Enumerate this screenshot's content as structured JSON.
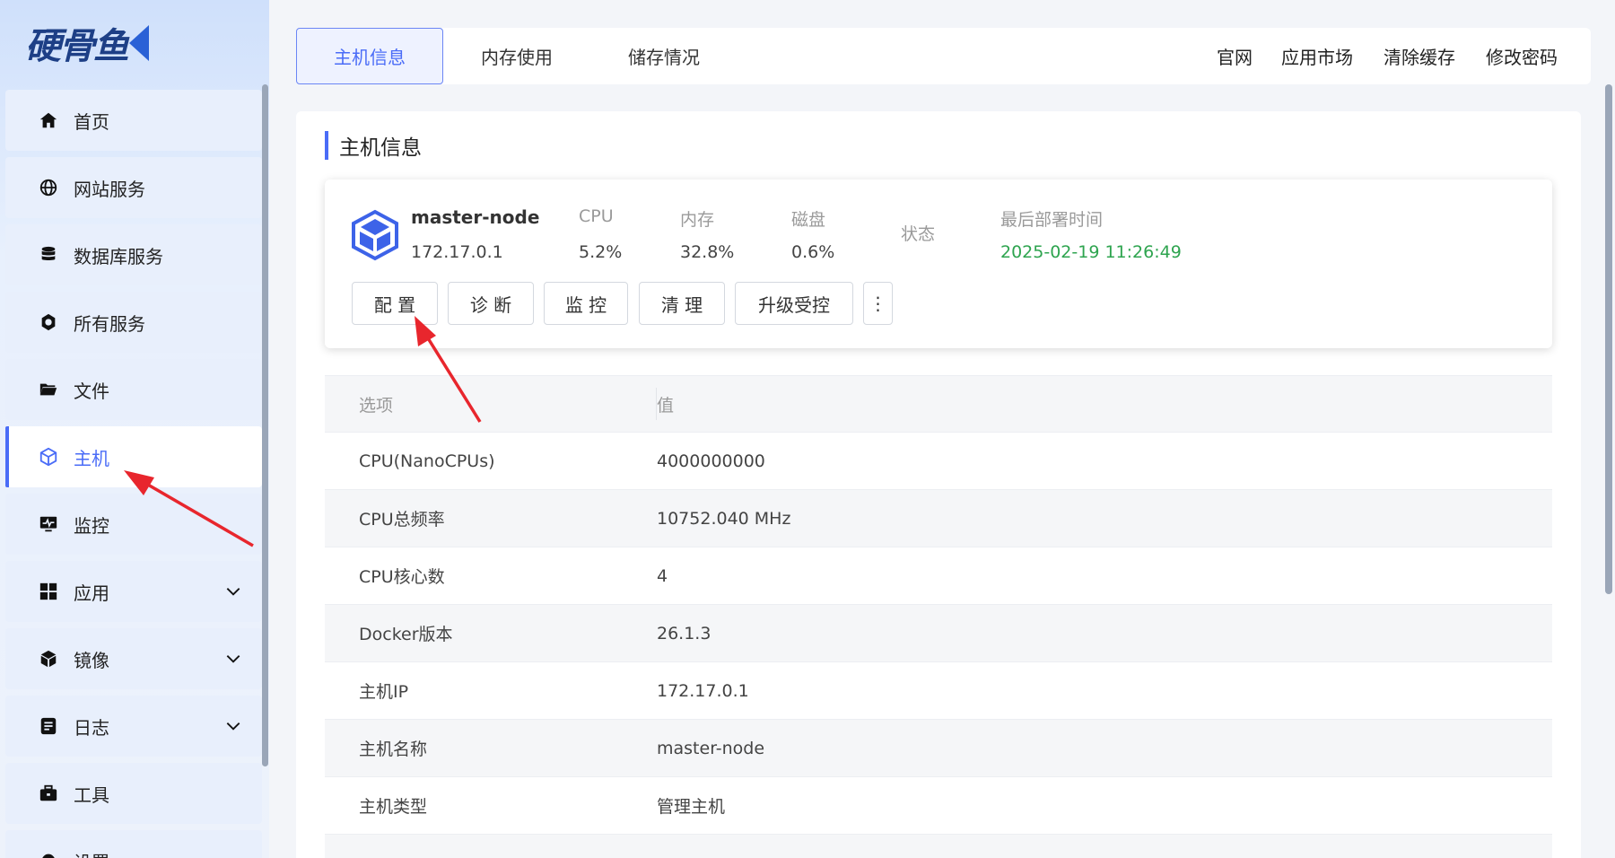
{
  "logo": {
    "text": "硬骨鱼"
  },
  "sidebar": {
    "items": [
      {
        "label": "首页",
        "icon": "home-icon"
      },
      {
        "label": "网站服务",
        "icon": "globe-icon"
      },
      {
        "label": "数据库服务",
        "icon": "database-icon"
      },
      {
        "label": "所有服务",
        "icon": "services-icon"
      },
      {
        "label": "文件",
        "icon": "folder-icon"
      },
      {
        "label": "主机",
        "icon": "host-icon",
        "active": true
      },
      {
        "label": "监控",
        "icon": "monitor-icon"
      },
      {
        "label": "应用",
        "icon": "apps-icon",
        "expandable": true
      },
      {
        "label": "镜像",
        "icon": "image-box-icon",
        "expandable": true
      },
      {
        "label": "日志",
        "icon": "log-icon",
        "expandable": true
      },
      {
        "label": "工具",
        "icon": "toolbox-icon"
      },
      {
        "label": "设置",
        "icon": "gear-icon"
      }
    ]
  },
  "topbar": {
    "tabs": [
      {
        "label": "主机信息",
        "active": true
      },
      {
        "label": "内存使用"
      },
      {
        "label": "储存情况"
      }
    ],
    "links": [
      "官网",
      "应用市场",
      "清除缓存",
      "修改密码"
    ]
  },
  "main": {
    "title": "主机信息",
    "host": {
      "name": "master-node",
      "ip": "172.17.0.1",
      "stats": [
        {
          "label": "CPU",
          "value": "5.2%"
        },
        {
          "label": "内存",
          "value": "32.8%"
        },
        {
          "label": "磁盘",
          "value": "0.6%"
        }
      ],
      "status_label": "状态",
      "deploy_label": "最后部署时间",
      "deploy_time": "2025-02-19 11:26:49",
      "buttons": [
        "配 置",
        "诊 断",
        "监 控",
        "清 理",
        "升级受控",
        "⋮"
      ]
    },
    "table": {
      "headers": [
        "选项",
        "值"
      ],
      "rows": [
        [
          "CPU(NanoCPUs)",
          "4000000000"
        ],
        [
          "CPU总频率",
          "10752.040 MHz"
        ],
        [
          "CPU核心数",
          "4"
        ],
        [
          "Docker版本",
          "26.1.3"
        ],
        [
          "主机IP",
          "172.17.0.1"
        ],
        [
          "主机名称",
          "master-node"
        ],
        [
          "主机类型",
          "管理主机"
        ]
      ]
    }
  },
  "colors": {
    "accent": "#4a6cf7",
    "success": "#2ea44f",
    "arrow": "#e8262d"
  }
}
